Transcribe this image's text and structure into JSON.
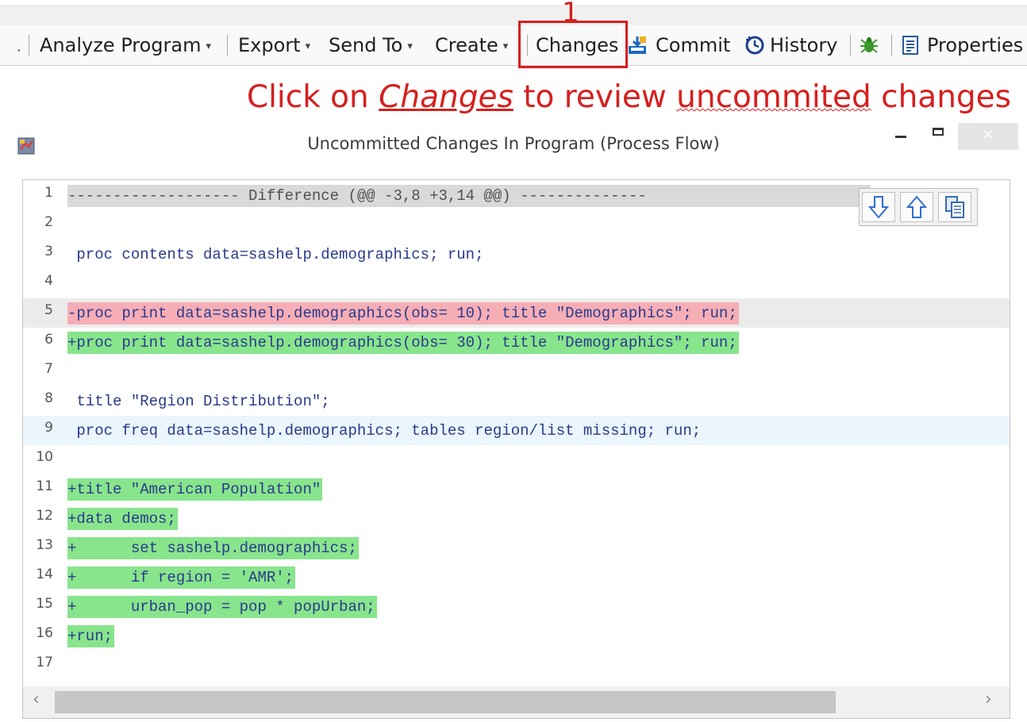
{
  "toolbar": {
    "leading_sep": ".",
    "items": [
      {
        "label": "Analyze Program",
        "has_caret": true
      },
      {
        "label": "Export",
        "has_caret": true
      },
      {
        "label": "Send To",
        "has_caret": true
      },
      {
        "label": "Create",
        "has_caret": true
      },
      {
        "label": "Changes",
        "has_caret": false
      },
      {
        "label": "Commit",
        "icon": "commit-icon"
      },
      {
        "label": "History",
        "icon": "history-icon"
      },
      {
        "label": "",
        "icon": "bug-icon"
      },
      {
        "label": "Properties",
        "icon": "properties-icon"
      }
    ],
    "caret": "▾"
  },
  "annotation": {
    "step_number": "1",
    "part1": "Click on ",
    "emph": "Changes",
    "part2": " to review ",
    "spell": "uncommited",
    "part3": " changes"
  },
  "dialog": {
    "title": "Uncommitted Changes In Program (Process Flow)",
    "close_glyph": "✕"
  },
  "editor": {
    "lines": [
      {
        "num": "1",
        "text": "------------------- Difference (@@ -3,8 +3,14 @@) --------------",
        "type": "hdr"
      },
      {
        "num": "2",
        "text": "",
        "type": "ctx"
      },
      {
        "num": "3",
        "text": " proc contents data=sashelp.demographics; run;",
        "type": "ctx"
      },
      {
        "num": "4",
        "text": "",
        "type": "ctx"
      },
      {
        "num": "5",
        "text": "-proc print data=sashelp.demographics(obs= 10); title \"Demographics\"; run;",
        "type": "del"
      },
      {
        "num": "6",
        "text": "+proc print data=sashelp.demographics(obs= 30); title \"Demographics\"; run;",
        "type": "add"
      },
      {
        "num": "7",
        "text": "",
        "type": "ctx"
      },
      {
        "num": "8",
        "text": " title \"Region Distribution\";",
        "type": "ctx"
      },
      {
        "num": "9",
        "text": " proc freq data=sashelp.demographics; tables region/list missing; run;",
        "type": "cur"
      },
      {
        "num": "10",
        "text": "",
        "type": "ctx"
      },
      {
        "num": "11",
        "text": "+title \"American Population\"",
        "type": "add"
      },
      {
        "num": "12",
        "text": "+data demos;",
        "type": "add"
      },
      {
        "num": "13",
        "text": "+      set sashelp.demographics;",
        "type": "add"
      },
      {
        "num": "14",
        "text": "+      if region = 'AMR';",
        "type": "add"
      },
      {
        "num": "15",
        "text": "+      urban_pop = pop * popUrban;",
        "type": "add"
      },
      {
        "num": "16",
        "text": "+run;",
        "type": "add"
      },
      {
        "num": "17",
        "text": "",
        "type": "ctx"
      }
    ],
    "nav_buttons": [
      "next-change-icon",
      "previous-change-icon",
      "copy-icon"
    ],
    "scroll_left": "‹",
    "scroll_right": "›"
  },
  "colors": {
    "accent_red": "#d42020",
    "added_bg": "#88e58c",
    "removed_bg": "#f6aeb6",
    "header_bg": "#d9d9d9",
    "code_text": "#2a3a8c"
  }
}
